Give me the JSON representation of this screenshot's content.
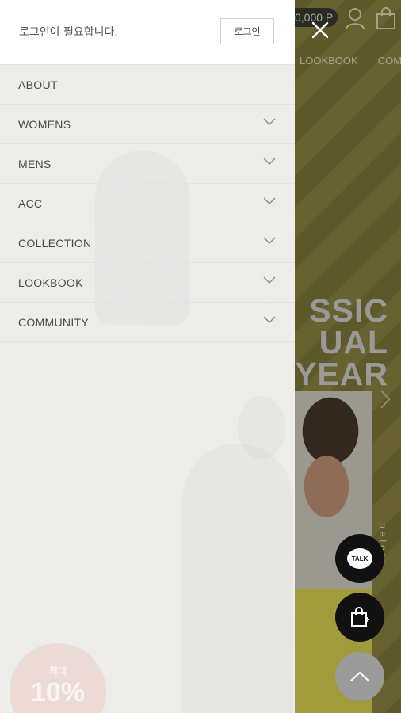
{
  "colors": {
    "drawer_bg": "#f7f7f7",
    "page_bg": "#7c7538",
    "float_dark": "#111111",
    "float_gray": "#9b9b9b"
  },
  "header": {
    "login_message": "로그인이 필요합니다.",
    "login_button": "로그인",
    "close_icon": "close-icon"
  },
  "menu": {
    "items": [
      {
        "label": "ABOUT",
        "expandable": false
      },
      {
        "label": "WOMENS",
        "expandable": true
      },
      {
        "label": "MENS",
        "expandable": true
      },
      {
        "label": "ACC",
        "expandable": true
      },
      {
        "label": "COLLECTION",
        "expandable": true
      },
      {
        "label": "LOOKBOOK",
        "expandable": true
      },
      {
        "label": "COMMUNITY",
        "expandable": true
      }
    ]
  },
  "background_page": {
    "points": "0,000 P",
    "nav": [
      "LOOKBOOK",
      "COMMUNITY"
    ],
    "headline": [
      "SSIC",
      "UAL",
      "YEAR"
    ],
    "vertical_text": "pelote",
    "badge_small": "최대",
    "badge_big": "10%"
  },
  "floating": {
    "talk_label": "TALK",
    "icons": [
      "kakaotalk-icon",
      "shopping-bag-icon",
      "arrow-up-icon"
    ]
  }
}
